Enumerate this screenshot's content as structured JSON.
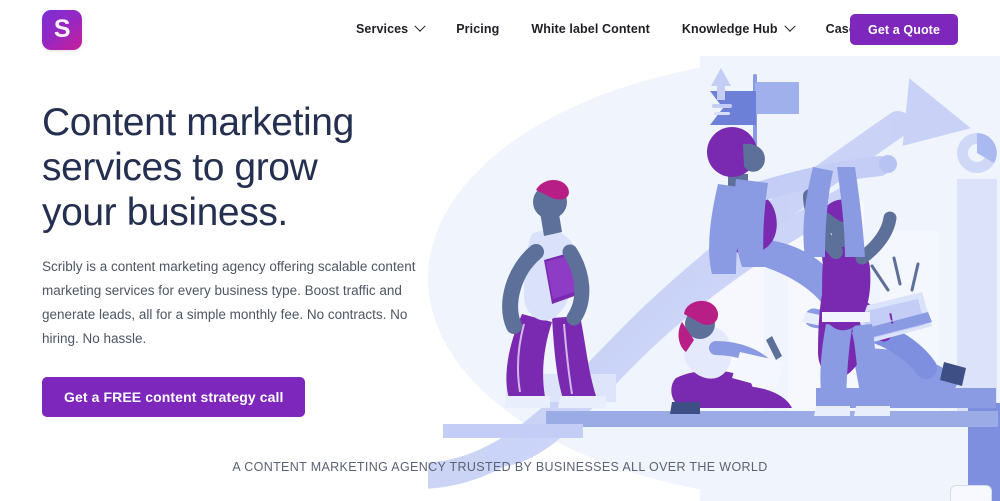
{
  "brand": {
    "logo_letter": "S",
    "logo_name": "scribly-logo",
    "gradient_from": "#7b2fd4",
    "gradient_to": "#c81f98"
  },
  "colors": {
    "accent_purple": "#7d27bd",
    "headline_navy": "#253050",
    "body_gray": "#4e5563",
    "hero_backdrop": "#f0f4fc",
    "illustration_light_blue": "#c3cdf5",
    "illustration_blue": "#7f8fe0",
    "illustration_purple": "#7a2ab0",
    "illustration_magenta": "#b81f86"
  },
  "nav": {
    "items": [
      {
        "label": "Services",
        "has_dropdown": true
      },
      {
        "label": "Pricing",
        "has_dropdown": false
      },
      {
        "label": "White label Content",
        "has_dropdown": false
      },
      {
        "label": "Knowledge Hub",
        "has_dropdown": true
      },
      {
        "label": "Case Studies",
        "has_dropdown": false
      }
    ],
    "cta_label": "Get a Quote"
  },
  "hero": {
    "headline_line1": "Content marketing",
    "headline_line2": "services to grow",
    "headline_line3": "your business.",
    "subcopy": "Scribly is a content marketing agency offering scalable content marketing services for every business type. Boost traffic and generate leads, all for a simple monthly fee. No contracts. No hiring. No hassle.",
    "cta_label": "Get a FREE content strategy call"
  },
  "trust": {
    "text": "A CONTENT MARKETING AGENCY TRUSTED BY BUSINESSES ALL OVER THE WORLD"
  },
  "illustration": {
    "alt": "People climbing a rising growth curve with charts, a flag and laptops",
    "elements": [
      "growth-arrow",
      "flag",
      "small-up-arrow",
      "bar-chart-columns",
      "donut-chart",
      "person-with-laptop",
      "person-sitting-on-column",
      "person-climbing",
      "person-reading",
      "person-reaching-up"
    ]
  }
}
